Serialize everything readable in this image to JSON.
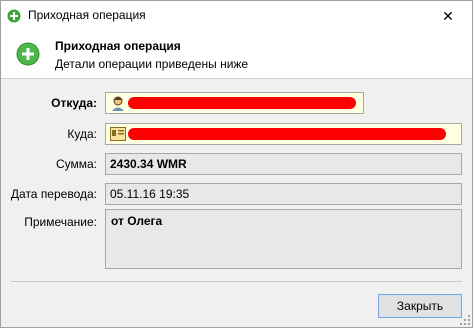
{
  "window": {
    "title": "Приходная операция",
    "close_glyph": "✕"
  },
  "header": {
    "title": "Приходная операция",
    "subtitle": "Детали операции приведены ниже",
    "icon": "plus-circle-icon",
    "accent": "#3aa63a"
  },
  "form": {
    "from_label": "Откуда:",
    "to_label": "Куда:",
    "amount_label": "Сумма:",
    "amount_value": "2430.34 WMR",
    "date_label": "Дата перевода:",
    "date_value": "05.11.16 19:35",
    "note_label": "Примечание:",
    "note_value": "от Олега"
  },
  "buttons": {
    "close_label": "Закрыть"
  },
  "colors": {
    "redaction": "#ff0000",
    "field_highlight": "#ffffe1",
    "field_readonly": "#e8e8e8"
  }
}
